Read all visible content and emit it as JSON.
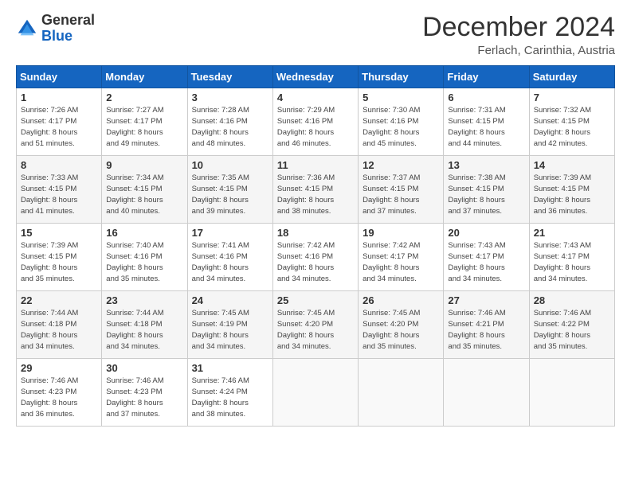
{
  "logo": {
    "general": "General",
    "blue": "Blue"
  },
  "title": "December 2024",
  "subtitle": "Ferlach, Carinthia, Austria",
  "days_header": [
    "Sunday",
    "Monday",
    "Tuesday",
    "Wednesday",
    "Thursday",
    "Friday",
    "Saturday"
  ],
  "weeks": [
    [
      {
        "day": "1",
        "info": "Sunrise: 7:26 AM\nSunset: 4:17 PM\nDaylight: 8 hours\nand 51 minutes."
      },
      {
        "day": "2",
        "info": "Sunrise: 7:27 AM\nSunset: 4:17 PM\nDaylight: 8 hours\nand 49 minutes."
      },
      {
        "day": "3",
        "info": "Sunrise: 7:28 AM\nSunset: 4:16 PM\nDaylight: 8 hours\nand 48 minutes."
      },
      {
        "day": "4",
        "info": "Sunrise: 7:29 AM\nSunset: 4:16 PM\nDaylight: 8 hours\nand 46 minutes."
      },
      {
        "day": "5",
        "info": "Sunrise: 7:30 AM\nSunset: 4:16 PM\nDaylight: 8 hours\nand 45 minutes."
      },
      {
        "day": "6",
        "info": "Sunrise: 7:31 AM\nSunset: 4:15 PM\nDaylight: 8 hours\nand 44 minutes."
      },
      {
        "day": "7",
        "info": "Sunrise: 7:32 AM\nSunset: 4:15 PM\nDaylight: 8 hours\nand 42 minutes."
      }
    ],
    [
      {
        "day": "8",
        "info": "Sunrise: 7:33 AM\nSunset: 4:15 PM\nDaylight: 8 hours\nand 41 minutes."
      },
      {
        "day": "9",
        "info": "Sunrise: 7:34 AM\nSunset: 4:15 PM\nDaylight: 8 hours\nand 40 minutes."
      },
      {
        "day": "10",
        "info": "Sunrise: 7:35 AM\nSunset: 4:15 PM\nDaylight: 8 hours\nand 39 minutes."
      },
      {
        "day": "11",
        "info": "Sunrise: 7:36 AM\nSunset: 4:15 PM\nDaylight: 8 hours\nand 38 minutes."
      },
      {
        "day": "12",
        "info": "Sunrise: 7:37 AM\nSunset: 4:15 PM\nDaylight: 8 hours\nand 37 minutes."
      },
      {
        "day": "13",
        "info": "Sunrise: 7:38 AM\nSunset: 4:15 PM\nDaylight: 8 hours\nand 37 minutes."
      },
      {
        "day": "14",
        "info": "Sunrise: 7:39 AM\nSunset: 4:15 PM\nDaylight: 8 hours\nand 36 minutes."
      }
    ],
    [
      {
        "day": "15",
        "info": "Sunrise: 7:39 AM\nSunset: 4:15 PM\nDaylight: 8 hours\nand 35 minutes."
      },
      {
        "day": "16",
        "info": "Sunrise: 7:40 AM\nSunset: 4:16 PM\nDaylight: 8 hours\nand 35 minutes."
      },
      {
        "day": "17",
        "info": "Sunrise: 7:41 AM\nSunset: 4:16 PM\nDaylight: 8 hours\nand 34 minutes."
      },
      {
        "day": "18",
        "info": "Sunrise: 7:42 AM\nSunset: 4:16 PM\nDaylight: 8 hours\nand 34 minutes."
      },
      {
        "day": "19",
        "info": "Sunrise: 7:42 AM\nSunset: 4:17 PM\nDaylight: 8 hours\nand 34 minutes."
      },
      {
        "day": "20",
        "info": "Sunrise: 7:43 AM\nSunset: 4:17 PM\nDaylight: 8 hours\nand 34 minutes."
      },
      {
        "day": "21",
        "info": "Sunrise: 7:43 AM\nSunset: 4:17 PM\nDaylight: 8 hours\nand 34 minutes."
      }
    ],
    [
      {
        "day": "22",
        "info": "Sunrise: 7:44 AM\nSunset: 4:18 PM\nDaylight: 8 hours\nand 34 minutes."
      },
      {
        "day": "23",
        "info": "Sunrise: 7:44 AM\nSunset: 4:18 PM\nDaylight: 8 hours\nand 34 minutes."
      },
      {
        "day": "24",
        "info": "Sunrise: 7:45 AM\nSunset: 4:19 PM\nDaylight: 8 hours\nand 34 minutes."
      },
      {
        "day": "25",
        "info": "Sunrise: 7:45 AM\nSunset: 4:20 PM\nDaylight: 8 hours\nand 34 minutes."
      },
      {
        "day": "26",
        "info": "Sunrise: 7:45 AM\nSunset: 4:20 PM\nDaylight: 8 hours\nand 35 minutes."
      },
      {
        "day": "27",
        "info": "Sunrise: 7:46 AM\nSunset: 4:21 PM\nDaylight: 8 hours\nand 35 minutes."
      },
      {
        "day": "28",
        "info": "Sunrise: 7:46 AM\nSunset: 4:22 PM\nDaylight: 8 hours\nand 35 minutes."
      }
    ],
    [
      {
        "day": "29",
        "info": "Sunrise: 7:46 AM\nSunset: 4:23 PM\nDaylight: 8 hours\nand 36 minutes."
      },
      {
        "day": "30",
        "info": "Sunrise: 7:46 AM\nSunset: 4:23 PM\nDaylight: 8 hours\nand 37 minutes."
      },
      {
        "day": "31",
        "info": "Sunrise: 7:46 AM\nSunset: 4:24 PM\nDaylight: 8 hours\nand 38 minutes."
      },
      {
        "day": "",
        "info": ""
      },
      {
        "day": "",
        "info": ""
      },
      {
        "day": "",
        "info": ""
      },
      {
        "day": "",
        "info": ""
      }
    ]
  ]
}
